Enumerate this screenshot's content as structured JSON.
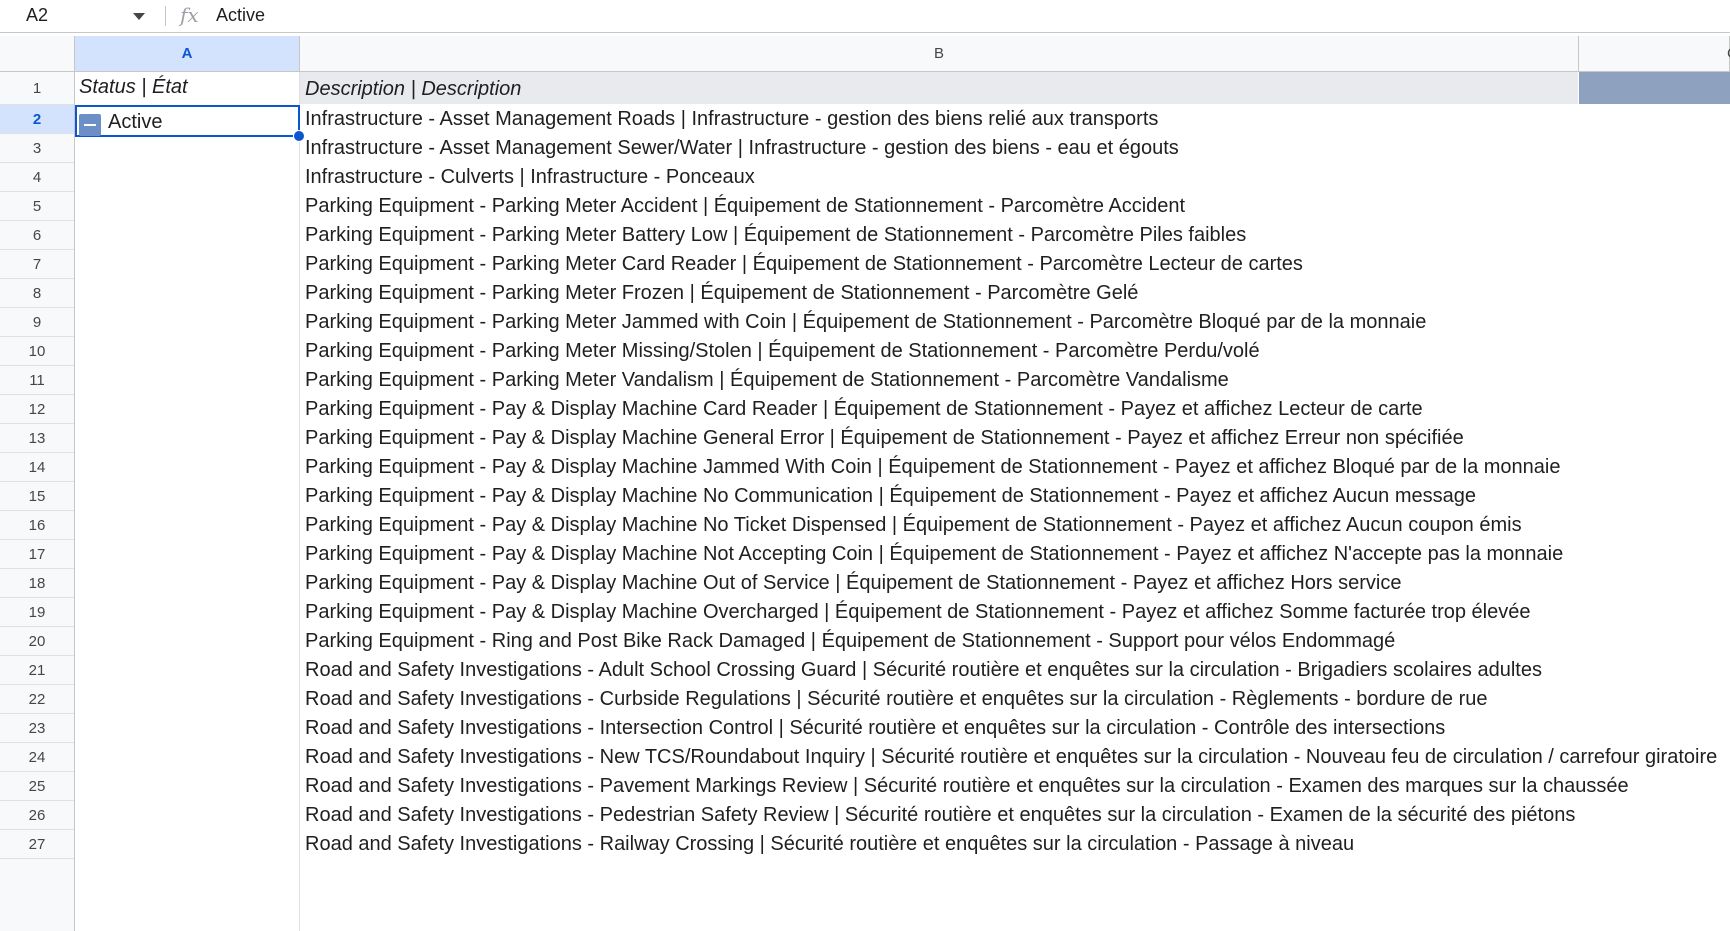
{
  "formula_bar": {
    "cell_ref": "A2",
    "formula_value": "Active"
  },
  "columns": [
    "A",
    "B",
    "C"
  ],
  "header_row": {
    "col_a": "Status | État",
    "col_b": "Description | Description"
  },
  "selected_cell": {
    "value": "Active"
  },
  "row_numbers": [
    "1",
    "2",
    "3",
    "4",
    "5",
    "6",
    "7",
    "8",
    "9",
    "10",
    "11",
    "12",
    "13",
    "14",
    "15",
    "16",
    "17",
    "18",
    "19",
    "20",
    "21",
    "22",
    "23",
    "24",
    "25",
    "26",
    "27"
  ],
  "descriptions": [
    "Infrastructure - Asset Management Roads | Infrastructure - gestion des biens relié aux transports",
    "Infrastructure - Asset Management Sewer/Water | Infrastructure - gestion des biens - eau et égouts",
    "Infrastructure - Culverts | Infrastructure - Ponceaux",
    "Parking Equipment - Parking Meter Accident | Équipement de Stationnement -  Parcomètre Accident",
    "Parking Equipment - Parking Meter Battery Low | Équipement de Stationnement -  Parcomètre Piles faibles",
    "Parking Equipment - Parking Meter Card Reader | Équipement de Stationnement -  Parcomètre Lecteur de cartes",
    "Parking Equipment - Parking Meter Frozen | Équipement de Stationnement -  Parcomètre Gelé",
    "Parking Equipment - Parking Meter Jammed with Coin | Équipement de Stationnement -  Parcomètre Bloqué par de la monnaie",
    "Parking Equipment - Parking Meter Missing/Stolen | Équipement de Stationnement -  Parcomètre Perdu/volé",
    "Parking Equipment - Parking Meter Vandalism | Équipement de Stationnement -  Parcomètre Vandalisme",
    "Parking Equipment - Pay & Display Machine Card Reader | Équipement de Stationnement - Payez et affichez Lecteur de carte",
    "Parking Equipment - Pay & Display Machine General Error | Équipement de Stationnement - Payez et affichez Erreur non spécifiée",
    "Parking Equipment - Pay & Display Machine Jammed With Coin | Équipement de Stationnement - Payez et affichez Bloqué par de la monnaie",
    "Parking Equipment - Pay & Display Machine No Communication | Équipement de Stationnement - Payez et affichez Aucun message",
    "Parking Equipment - Pay & Display Machine No Ticket Dispensed | Équipement de Stationnement - Payez et affichez Aucun coupon émis",
    "Parking Equipment - Pay & Display Machine Not Accepting Coin | Équipement de Stationnement - Payez et affichez N'accepte pas la monnaie",
    "Parking Equipment - Pay & Display Machine Out of Service | Équipement de Stationnement - Payez et affichez Hors service",
    "Parking Equipment - Pay & Display Machine Overcharged | Équipement de Stationnement - Payez et affichez Somme facturée trop élevée",
    "Parking Equipment - Ring and Post Bike Rack Damaged | Équipement de Stationnement - Support pour vélos Endommagé",
    "Road and Safety Investigations - Adult School Crossing Guard | Sécurité routière et enquêtes sur la circulation - Brigadiers scolaires adultes",
    "Road and Safety Investigations - Curbside Regulations | Sécurité routière et enquêtes sur la circulation - Règlements - bordure de rue",
    "Road and Safety Investigations - Intersection Control | Sécurité routière et enquêtes sur la circulation - Contrôle des intersections",
    "Road and Safety Investigations - New TCS/Roundabout Inquiry | Sécurité routière et enquêtes sur la circulation - Nouveau feu de circulation / carrefour giratoire",
    "Road and Safety Investigations - Pavement Markings Review | Sécurité routière et enquêtes sur la circulation - Examen des marques sur la chaussée",
    "Road and Safety Investigations - Pedestrian Safety Review | Sécurité routière et enquêtes sur la circulation - Examen de la sécurité des piétons",
    "Road and Safety Investigations - Railway Crossing | Sécurité routière et enquêtes sur la circulation - Passage à niveau"
  ]
}
